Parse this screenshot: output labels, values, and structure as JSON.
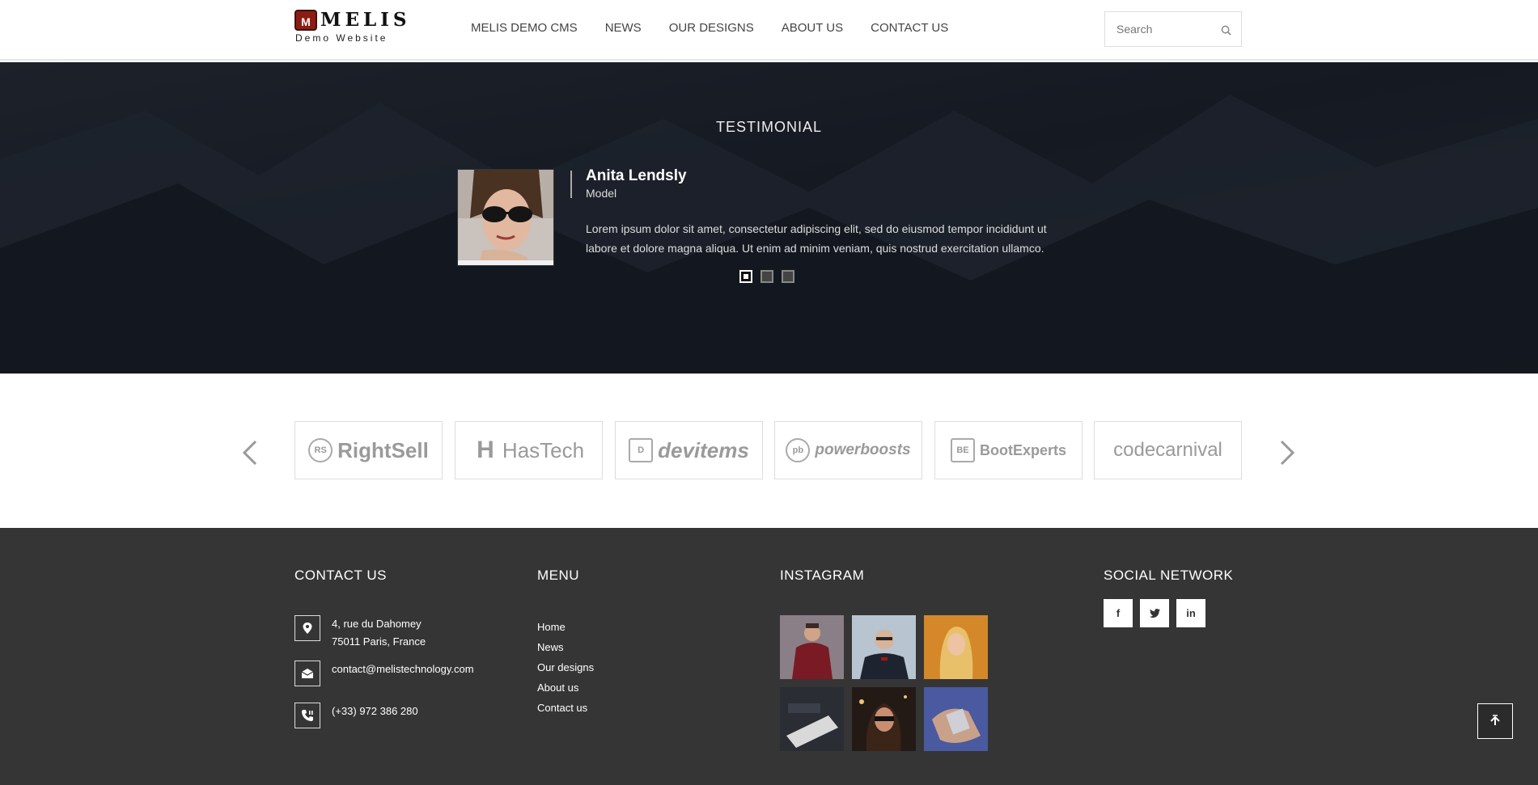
{
  "header": {
    "logo_badge": "M",
    "logo_text": "MELIS",
    "logo_sub": "Demo Website",
    "nav": [
      "MELIS DEMO CMS",
      "NEWS",
      "OUR DESIGNS",
      "ABOUT US",
      "CONTACT US"
    ],
    "search_placeholder": "Search"
  },
  "testimonial": {
    "title": "TESTIMONIAL",
    "name": "Anita Lendsly",
    "role": "Model",
    "quote": "Lorem ipsum dolor sit amet, consectetur adipiscing elit, sed do eiusmod tempor incididunt ut labore et dolore magna aliqua. Ut enim ad minim veniam, quis nostrud exercitation ullamco.",
    "slide_count": 3,
    "active_slide": 1
  },
  "brands": [
    "RightSell",
    "HasTech",
    "devitems",
    "powerboosts",
    "BootExperts",
    "codecarnival"
  ],
  "footer": {
    "contact": {
      "heading": "CONTACT US",
      "address_line1": "4, rue du Dahomey",
      "address_line2": "75011 Paris, France",
      "email": "contact@melistechnology.com",
      "phone": "(+33) 972 386 280"
    },
    "menu": {
      "heading": "MENU",
      "items": [
        "Home",
        "News",
        "Our designs",
        "About us",
        "Contact us"
      ]
    },
    "instagram": {
      "heading": "INSTAGRAM"
    },
    "social": {
      "heading": "SOCIAL NETWORK",
      "icons": [
        "f",
        "t",
        "in"
      ]
    }
  },
  "colors": {
    "footer_bg": "#353535",
    "testimonial_bg": "#171b24",
    "logo_badge": "#8e1c12"
  }
}
